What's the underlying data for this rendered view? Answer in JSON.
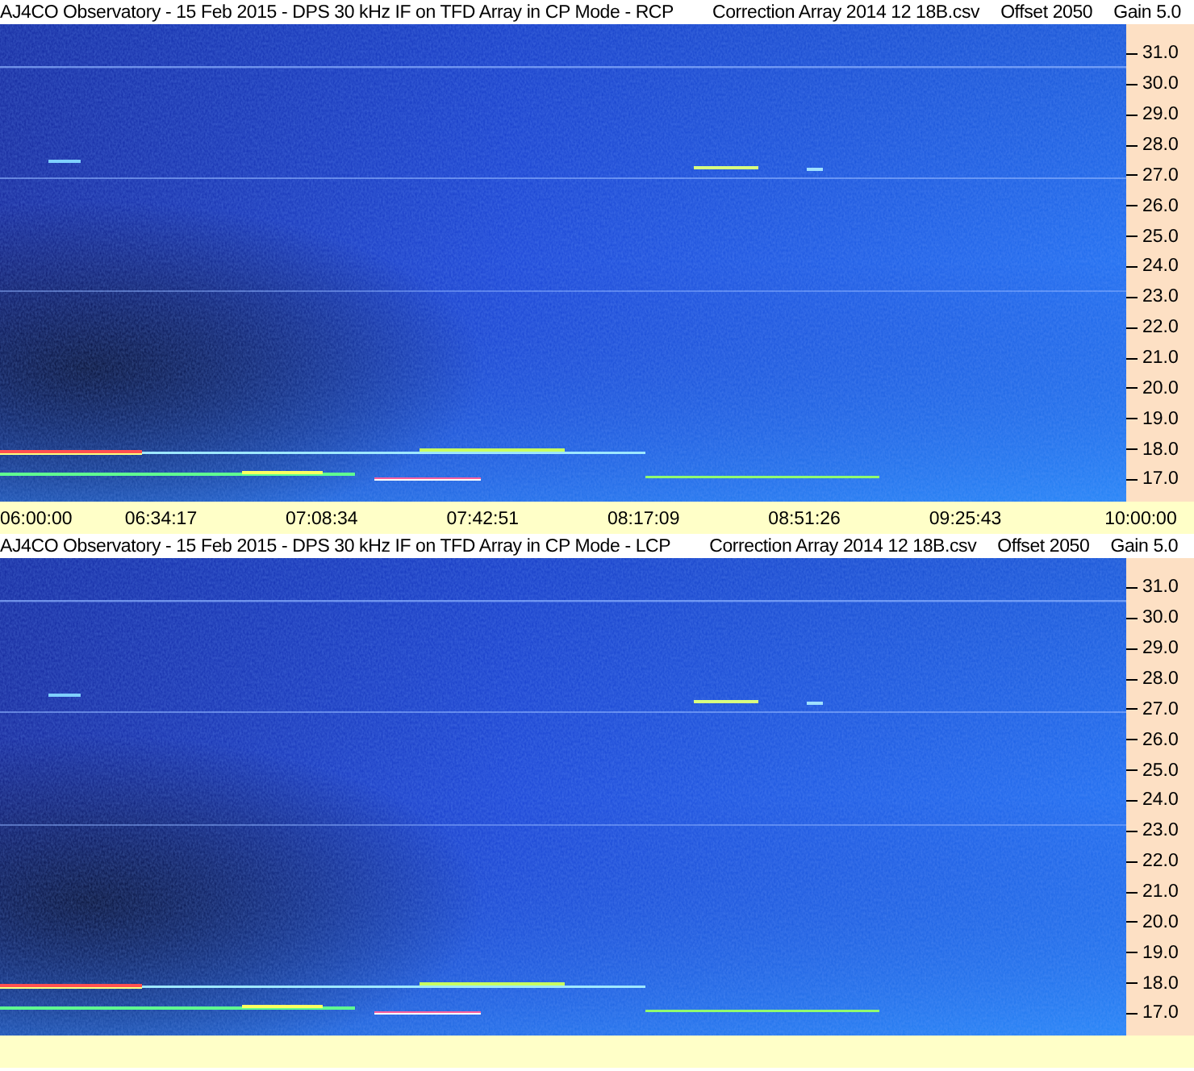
{
  "panels": [
    {
      "title": "AJ4CO Observatory - 15 Feb 2015 - DPS 30 kHz IF on TFD Array in CP Mode - RCP",
      "correction_file": "Correction Array 2014 12 18B.csv",
      "offset": "Offset 2050",
      "gain": "Gain 5.0",
      "y_ticks": [
        "31.0",
        "30.0",
        "29.0",
        "28.0",
        "27.0",
        "26.0",
        "25.0",
        "24.0",
        "23.0",
        "22.0",
        "21.0",
        "20.0",
        "19.0",
        "18.0",
        "17.0"
      ],
      "time_labels": [
        "06:00:00",
        "06:34:17",
        "07:08:34",
        "07:42:51",
        "08:17:09",
        "08:51:26",
        "09:25:43",
        "10:00:00"
      ]
    },
    {
      "title": "AJ4CO Observatory - 15 Feb 2015 - DPS 30 kHz IF on TFD Array in CP Mode - LCP",
      "correction_file": "Correction Array 2014 12 18B.csv",
      "offset": "Offset 2050",
      "gain": "Gain 5.0",
      "y_ticks": [
        "31.0",
        "30.0",
        "29.0",
        "28.0",
        "27.0",
        "26.0",
        "25.0",
        "24.0",
        "23.0",
        "22.0",
        "21.0",
        "20.0",
        "19.0",
        "18.0",
        "17.0"
      ]
    }
  ]
}
